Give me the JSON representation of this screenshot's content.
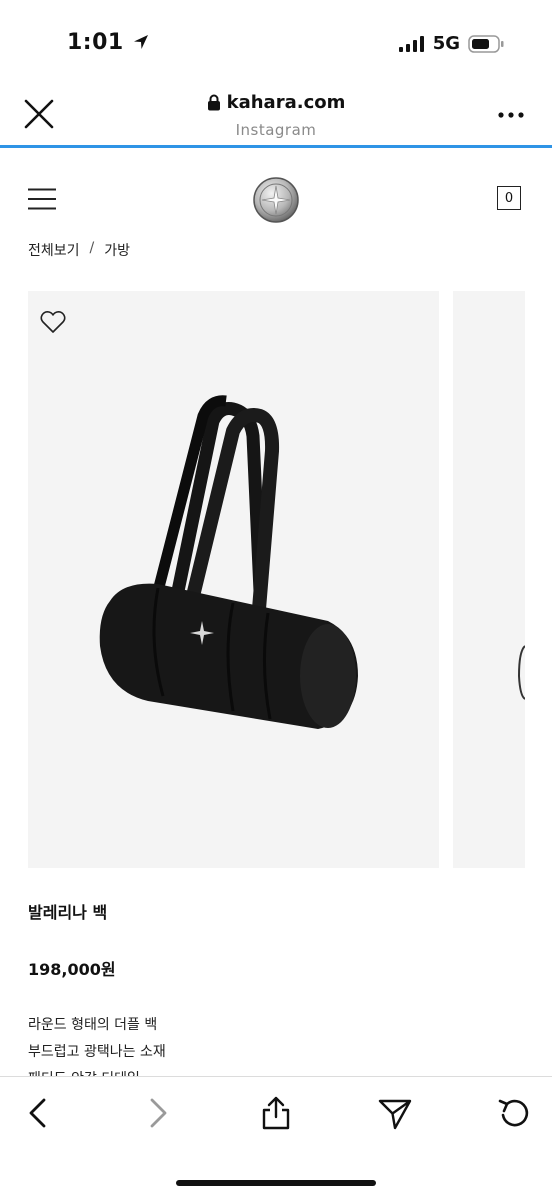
{
  "status_bar": {
    "time": "1:01",
    "network": "5G"
  },
  "browser": {
    "domain": "kahara.com",
    "subtitle": "Instagram"
  },
  "site": {
    "cart_count": "0"
  },
  "breadcrumb": {
    "items": [
      "전체보기",
      "가방"
    ],
    "separator": "/"
  },
  "product": {
    "name": "발레리나 백",
    "price": "198,000원",
    "description": [
      "라운드 형태의 더플 백",
      "부드럽고 광택나는 소재",
      "패디드 안감 디테일"
    ]
  },
  "colors": {
    "accent": "#2f94e6",
    "photo_bg": "#f4f4f4",
    "disabled": "#9a9a9a"
  },
  "icons": [
    "close-icon",
    "lock-icon",
    "more-icon",
    "menu-icon",
    "logo-icon",
    "heart-icon",
    "back-icon",
    "forward-icon",
    "share-icon",
    "send-icon",
    "reload-icon",
    "location-arrow-icon",
    "signal-icon",
    "battery-icon"
  ]
}
